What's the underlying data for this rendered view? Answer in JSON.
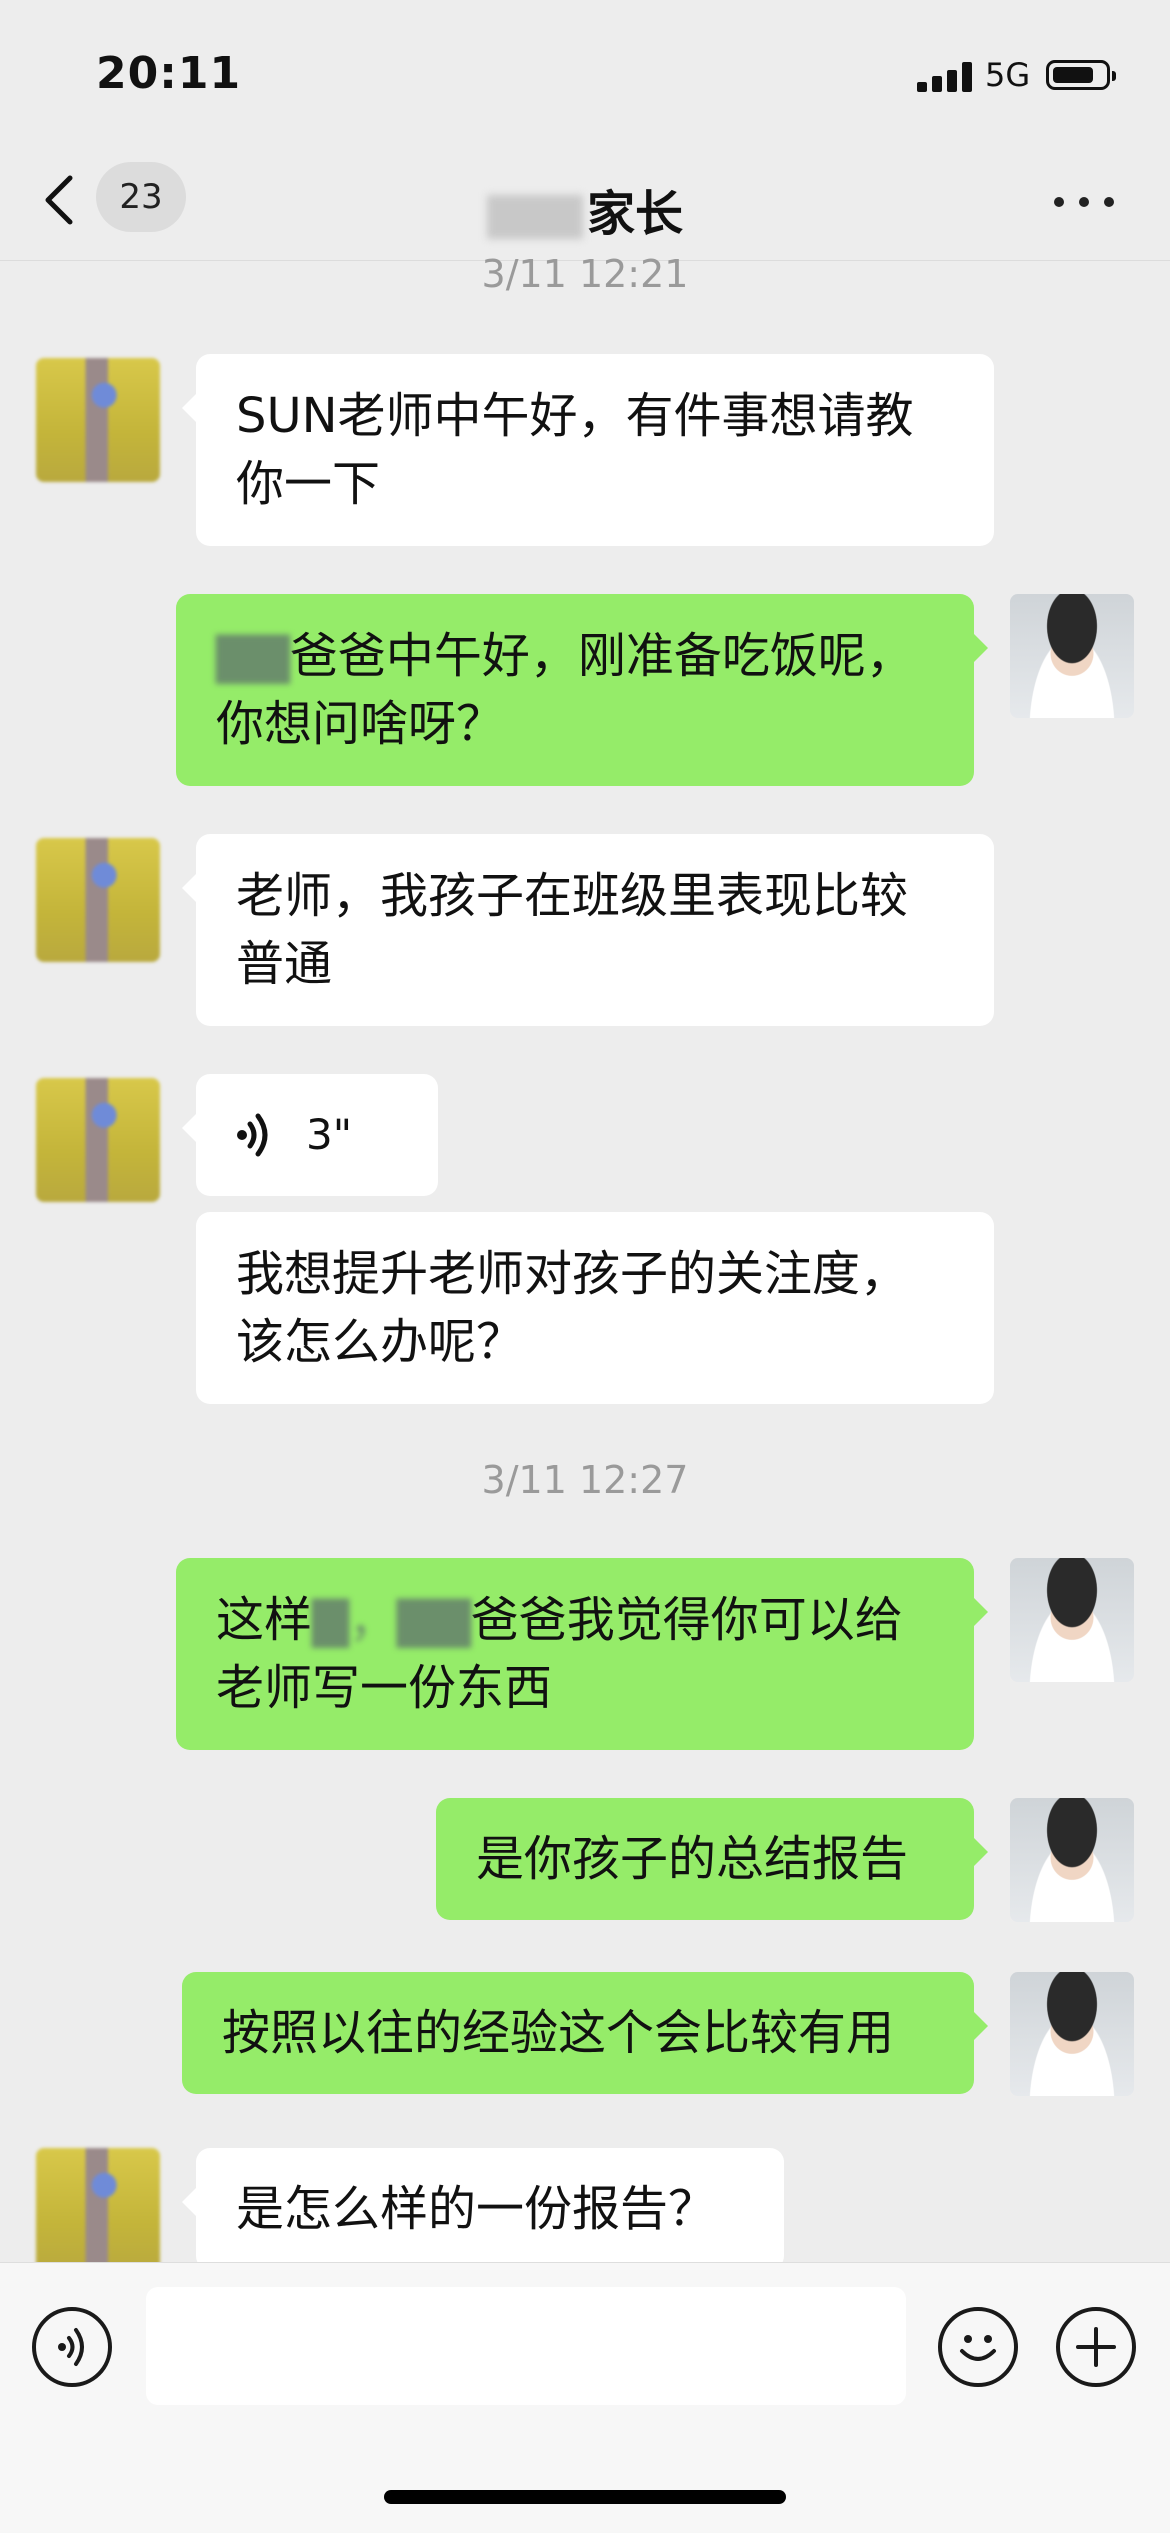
{
  "status_bar": {
    "time": "20:11",
    "network": "5G"
  },
  "nav": {
    "unread_count": "23",
    "title_visible": "家长"
  },
  "timestamps": [
    "3/11 12:21",
    "3/11 12:27"
  ],
  "messages": [
    {
      "side": "left",
      "text": "SUN老师中午好，有件事想请教你一下"
    },
    {
      "side": "right",
      "text_visible": "爸爸中午好，刚准备吃饭呢，你想问啥呀？"
    },
    {
      "side": "left",
      "text": "老师，我孩子在班级里表现比较普通"
    },
    {
      "side": "left",
      "type": "voice",
      "duration": "3\""
    },
    {
      "side": "left",
      "text": "我想提升老师对孩子的关注度，该怎么办呢？"
    },
    {
      "side": "right",
      "text_visible_a": "这样",
      "text_visible_b": "爸爸我觉得你可以给老师写一份东西"
    },
    {
      "side": "right",
      "text": "是你孩子的总结报告"
    },
    {
      "side": "right",
      "text": "按照以往的经验这个会比较有用"
    },
    {
      "side": "left",
      "text": "是怎么样的一份报告？"
    }
  ],
  "icons": {
    "back": "chevron-left-icon",
    "more": "more-dots-icon",
    "voice": "voice-wave-icon",
    "emoji": "emoji-icon",
    "plus": "plus-icon"
  },
  "colors": {
    "background": "#ededed",
    "bubble_self": "#95ec69",
    "bubble_other": "#ffffff",
    "timestamp": "#9a9a9a"
  }
}
